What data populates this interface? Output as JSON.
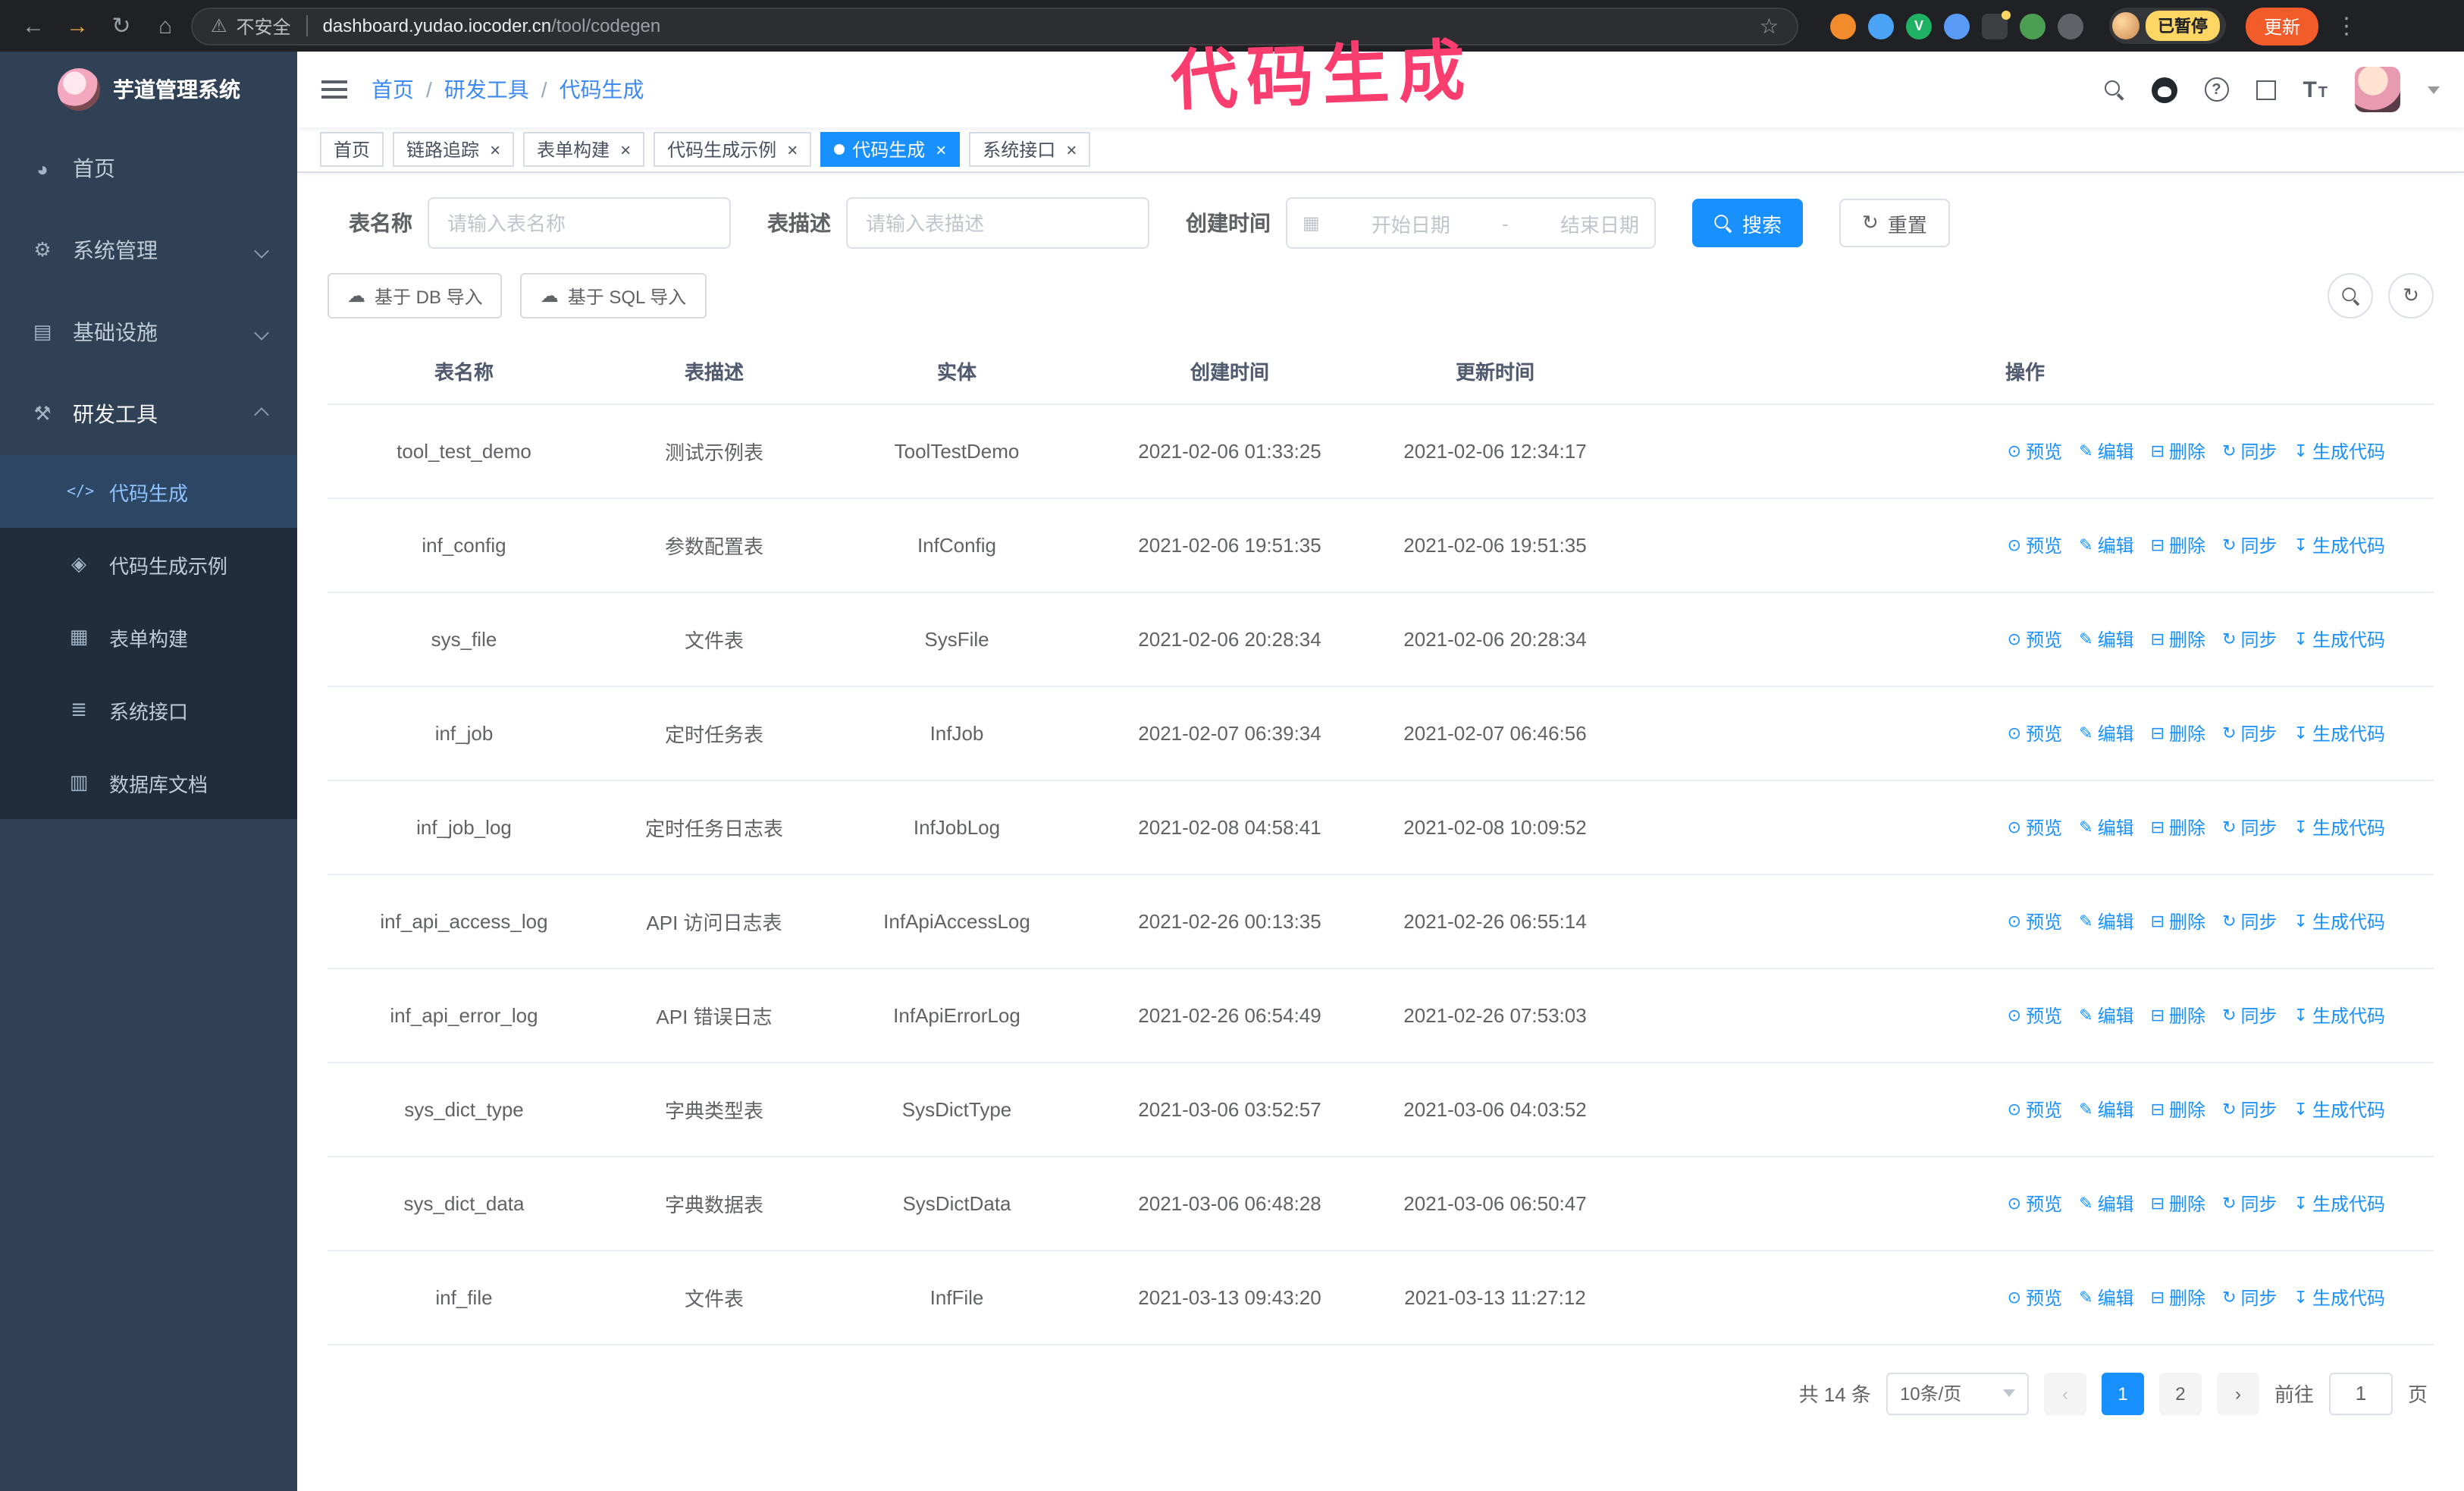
{
  "annotation": {
    "text": "代码生成"
  },
  "colors": {
    "accent": "#1890ff",
    "annotation": "#fa3d6f",
    "sidebar_bg": "#304156",
    "submenu_bg": "#1f2d3d",
    "update_button_bg": "#f25b2a",
    "paused_badge_bg": "#fdd663"
  },
  "icons": {
    "back": "←",
    "forward": "→",
    "reload": "↻",
    "home": "⌂",
    "warning": "⚠",
    "star": "☆",
    "dots": "⋮",
    "home_menu": "◕",
    "gear": "⚙",
    "infra": "▤",
    "tools": "⚒",
    "code": "</>",
    "example": "◈",
    "form": "▦",
    "api": "≣",
    "db": "▥",
    "close": "×",
    "calendar": "▦",
    "cloud": "☁",
    "eye": "⊙",
    "edit": "✎",
    "trash": "⊟",
    "sync": "↻",
    "download": "↧",
    "prev": "‹",
    "next": "›",
    "question": "?"
  },
  "browser": {
    "security_warning": "不安全",
    "url_host": "dashboard.yudao.iocoder.cn",
    "url_path": "/tool/codegen",
    "paused_badge": "已暂停",
    "update_button": "更新"
  },
  "sidebar": {
    "logo_title": "芋道管理系统",
    "items": [
      {
        "label": "首页"
      },
      {
        "label": "系统管理"
      },
      {
        "label": "基础设施"
      },
      {
        "label": "研发工具"
      }
    ],
    "submenu": [
      {
        "label": "代码生成",
        "active": true
      },
      {
        "label": "代码生成示例"
      },
      {
        "label": "表单构建"
      },
      {
        "label": "系统接口"
      },
      {
        "label": "数据库文档"
      }
    ]
  },
  "header": {
    "breadcrumb": [
      "首页",
      "研发工具",
      "代码生成"
    ],
    "separator": "/"
  },
  "tabs": [
    {
      "label": "首页",
      "closable": false,
      "active": false
    },
    {
      "label": "链路追踪",
      "closable": true,
      "active": false
    },
    {
      "label": "表单构建",
      "closable": true,
      "active": false
    },
    {
      "label": "代码生成示例",
      "closable": true,
      "active": false
    },
    {
      "label": "代码生成",
      "closable": true,
      "active": true
    },
    {
      "label": "系统接口",
      "closable": true,
      "active": false
    }
  ],
  "search_form": {
    "table_name_label": "表名称",
    "table_name_placeholder": "请输入表名称",
    "table_desc_label": "表描述",
    "table_desc_placeholder": "请输入表描述",
    "create_time_label": "创建时间",
    "date_start_placeholder": "开始日期",
    "date_separator": "-",
    "date_end_placeholder": "结束日期",
    "search_button": "搜索",
    "reset_button": "重置"
  },
  "toolbar": {
    "import_db_button": "基于 DB 导入",
    "import_sql_button": "基于 SQL 导入"
  },
  "table": {
    "columns": [
      "表名称",
      "表描述",
      "实体",
      "创建时间",
      "更新时间",
      "操作"
    ],
    "actions": [
      "预览",
      "编辑",
      "删除",
      "同步",
      "生成代码"
    ],
    "rows": [
      {
        "name": "tool_test_demo",
        "desc": "测试示例表",
        "entity": "ToolTestDemo",
        "created": "2021-02-06 01:33:25",
        "updated": "2021-02-06 12:34:17"
      },
      {
        "name": "inf_config",
        "desc": "参数配置表",
        "entity": "InfConfig",
        "created": "2021-02-06 19:51:35",
        "updated": "2021-02-06 19:51:35"
      },
      {
        "name": "sys_file",
        "desc": "文件表",
        "entity": "SysFile",
        "created": "2021-02-06 20:28:34",
        "updated": "2021-02-06 20:28:34"
      },
      {
        "name": "inf_job",
        "desc": "定时任务表",
        "entity": "InfJob",
        "created": "2021-02-07 06:39:34",
        "updated": "2021-02-07 06:46:56"
      },
      {
        "name": "inf_job_log",
        "desc": "定时任务日志表",
        "entity": "InfJobLog",
        "created": "2021-02-08 04:58:41",
        "updated": "2021-02-08 10:09:52"
      },
      {
        "name": "inf_api_access_log",
        "desc": "API 访问日志表",
        "entity": "InfApiAccessLog",
        "created": "2021-02-26 00:13:35",
        "updated": "2021-02-26 06:55:14"
      },
      {
        "name": "inf_api_error_log",
        "desc": "API 错误日志",
        "entity": "InfApiErrorLog",
        "created": "2021-02-26 06:54:49",
        "updated": "2021-02-26 07:53:03"
      },
      {
        "name": "sys_dict_type",
        "desc": "字典类型表",
        "entity": "SysDictType",
        "created": "2021-03-06 03:52:57",
        "updated": "2021-03-06 04:03:52"
      },
      {
        "name": "sys_dict_data",
        "desc": "字典数据表",
        "entity": "SysDictData",
        "created": "2021-03-06 06:48:28",
        "updated": "2021-03-06 06:50:47"
      },
      {
        "name": "inf_file",
        "desc": "文件表",
        "entity": "InfFile",
        "created": "2021-03-13 09:43:20",
        "updated": "2021-03-13 11:27:12"
      }
    ]
  },
  "pagination": {
    "total_text": "共 14 条",
    "page_size": "10条/页",
    "pages": [
      "1",
      "2"
    ],
    "goto_label": "前往",
    "goto_value": "1",
    "goto_suffix": "页"
  }
}
